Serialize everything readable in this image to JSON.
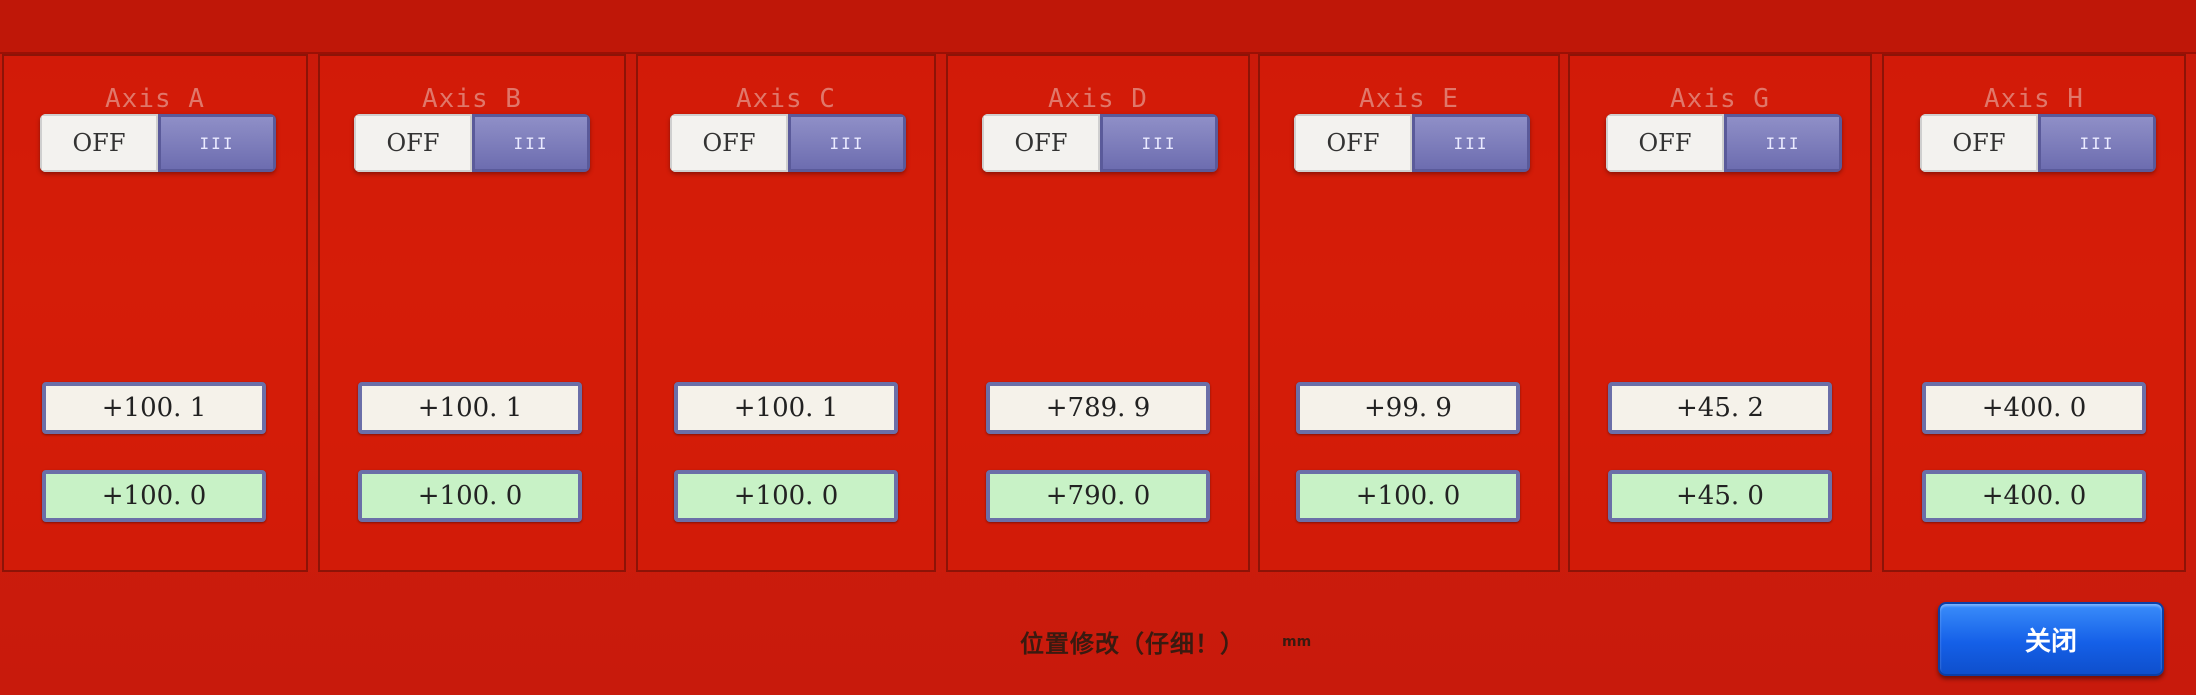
{
  "axes": [
    {
      "name": "Axis A",
      "toggle_state": "OFF",
      "knob_text": "III",
      "set_value": "+100. 1",
      "actual_value": "+100. 0"
    },
    {
      "name": "Axis B",
      "toggle_state": "OFF",
      "knob_text": "III",
      "set_value": "+100. 1",
      "actual_value": "+100. 0"
    },
    {
      "name": "Axis C",
      "toggle_state": "OFF",
      "knob_text": "III",
      "set_value": "+100. 1",
      "actual_value": "+100. 0"
    },
    {
      "name": "Axis D",
      "toggle_state": "OFF",
      "knob_text": "III",
      "set_value": "+789. 9",
      "actual_value": "+790. 0"
    },
    {
      "name": "Axis E",
      "toggle_state": "OFF",
      "knob_text": "III",
      "set_value": "+99. 9",
      "actual_value": "+100. 0"
    },
    {
      "name": "Axis G",
      "toggle_state": "OFF",
      "knob_text": "III",
      "set_value": "+45. 2",
      "actual_value": "+45. 0"
    },
    {
      "name": "Axis H",
      "toggle_state": "OFF",
      "knob_text": "III",
      "set_value": "+400. 0",
      "actual_value": "+400. 0"
    }
  ],
  "footer": {
    "label": "位置修改（仔细！）",
    "unit": "mm"
  },
  "close_button": {
    "label": "关闭"
  },
  "colors": {
    "background": "#c9190a",
    "set_value_bg": "#f5f2ea",
    "actual_value_bg": "#c8f2c6",
    "toggle_knob": "#7777b8",
    "close_button": "#1560e8"
  }
}
